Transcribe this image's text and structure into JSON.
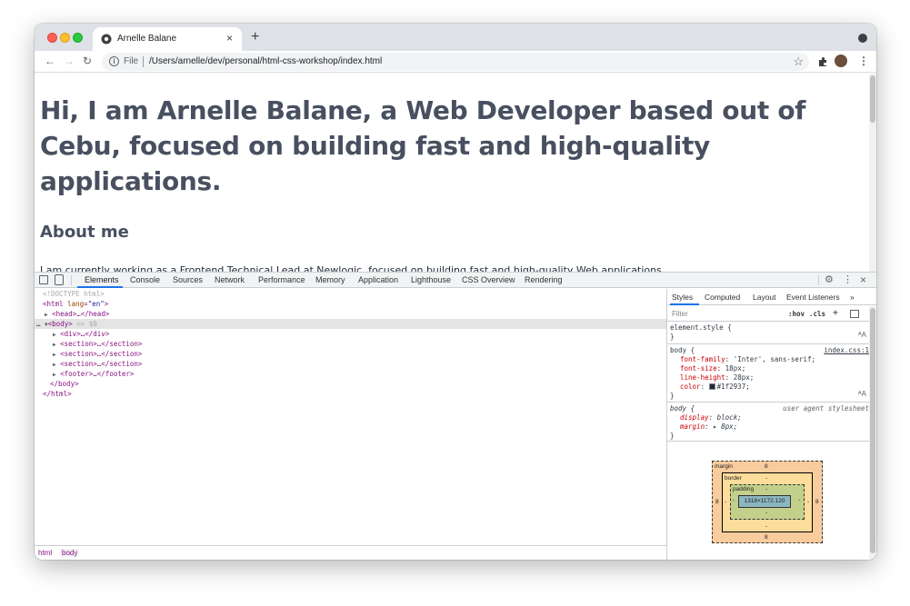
{
  "browser": {
    "tab_title": "Arnelle Balane",
    "tab_close": "×",
    "new_tab": "+",
    "file_label": "File",
    "url": "/Users/arnelle/dev/personal/html-css-workshop/index.html"
  },
  "page": {
    "hero": "Hi, I am Arnelle Balane, a Web Developer based out of Cebu, focused on building fast and high-quality applications.",
    "about_heading": "About me",
    "about_text": "I am currently working as a Frontend Technical Lead at Newlogic, focused on building fast and high-quality Web applications."
  },
  "devtools": {
    "tabs": [
      "Elements",
      "Console",
      "Sources",
      "Network",
      "Performance",
      "Memory",
      "Application",
      "Lighthouse",
      "CSS Overview",
      "Rendering"
    ],
    "active_tab": "Elements",
    "tree": {
      "doctype": "<!DOCTYPE html>",
      "html_open": "<html",
      "lang_attr": "lang",
      "lang_val": "\"en\"",
      "head": "<head>…</head>",
      "body_open": "<body>",
      "body_sel": "== $0",
      "div": "<div>…</div>",
      "section": "<section>…</section>",
      "footer": "<footer>…</footer>",
      "body_close": "</body>",
      "html_close": "</html>"
    },
    "breadcrumbs": [
      "html",
      "body"
    ],
    "styles": {
      "tabs": [
        "Styles",
        "Computed",
        "Layout",
        "Event Listeners",
        "»"
      ],
      "filter_placeholder": "Filter",
      "hov": ":hov",
      "cls": ".cls",
      "plus": "+",
      "element_style": "element.style {",
      "close_brace": "}",
      "body_selector": "body {",
      "source": "index.css:1",
      "font_family_prop": "font-family",
      "font_family_val": "'Inter', sans-serif;",
      "font_size_prop": "font-size",
      "font_size_val": "18px;",
      "line_height_prop": "line-height",
      "line_height_val": "28px;",
      "color_prop": "color",
      "color_val": "#1f2937;",
      "ua_label": "user agent stylesheet",
      "display_prop": "display",
      "display_val": "block;",
      "margin_prop": "margin",
      "margin_val": "▸ 8px;"
    },
    "box_model": {
      "margin_label": "margin",
      "margin_top": "8",
      "margin_bottom": "8",
      "margin_left": "8",
      "margin_right": "8",
      "border_label": "border",
      "border_val": "-",
      "padding_label": "padding",
      "padding_val": "-",
      "content": "1318×1172.120"
    }
  },
  "colors": {
    "heading": "#485060",
    "body_text": "#1f2937",
    "accent": "#1a73e8"
  }
}
